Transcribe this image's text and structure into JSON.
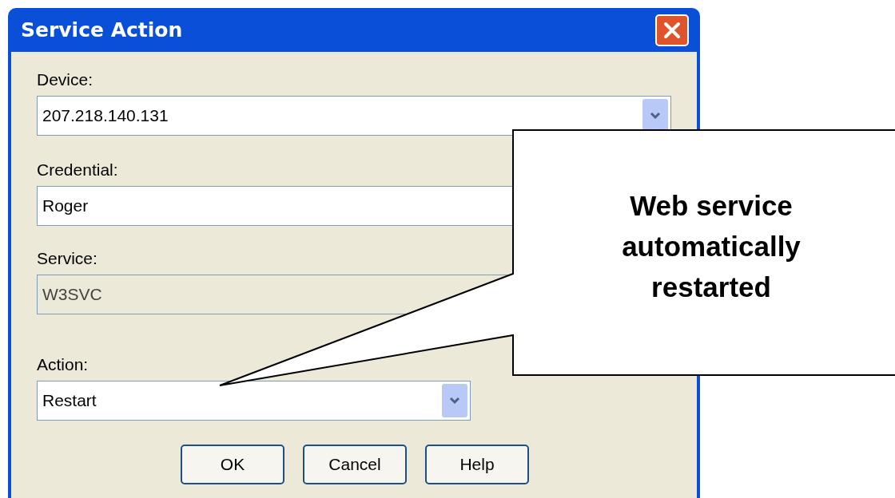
{
  "window": {
    "title": "Service Action"
  },
  "fields": [
    {
      "label": "Device:",
      "value": "207.218.140.131",
      "kind": "combo",
      "disabled": false
    },
    {
      "label": "Credential:",
      "value": "Roger",
      "kind": "text",
      "disabled": false
    },
    {
      "label": "Service:",
      "value": "W3SVC",
      "kind": "text",
      "disabled": true
    },
    {
      "label": "Action:",
      "value": "Restart",
      "kind": "combo",
      "disabled": false
    }
  ],
  "buttons": [
    "OK",
    "Cancel",
    "Help"
  ],
  "callout": {
    "text": "Web service automatically restarted"
  }
}
